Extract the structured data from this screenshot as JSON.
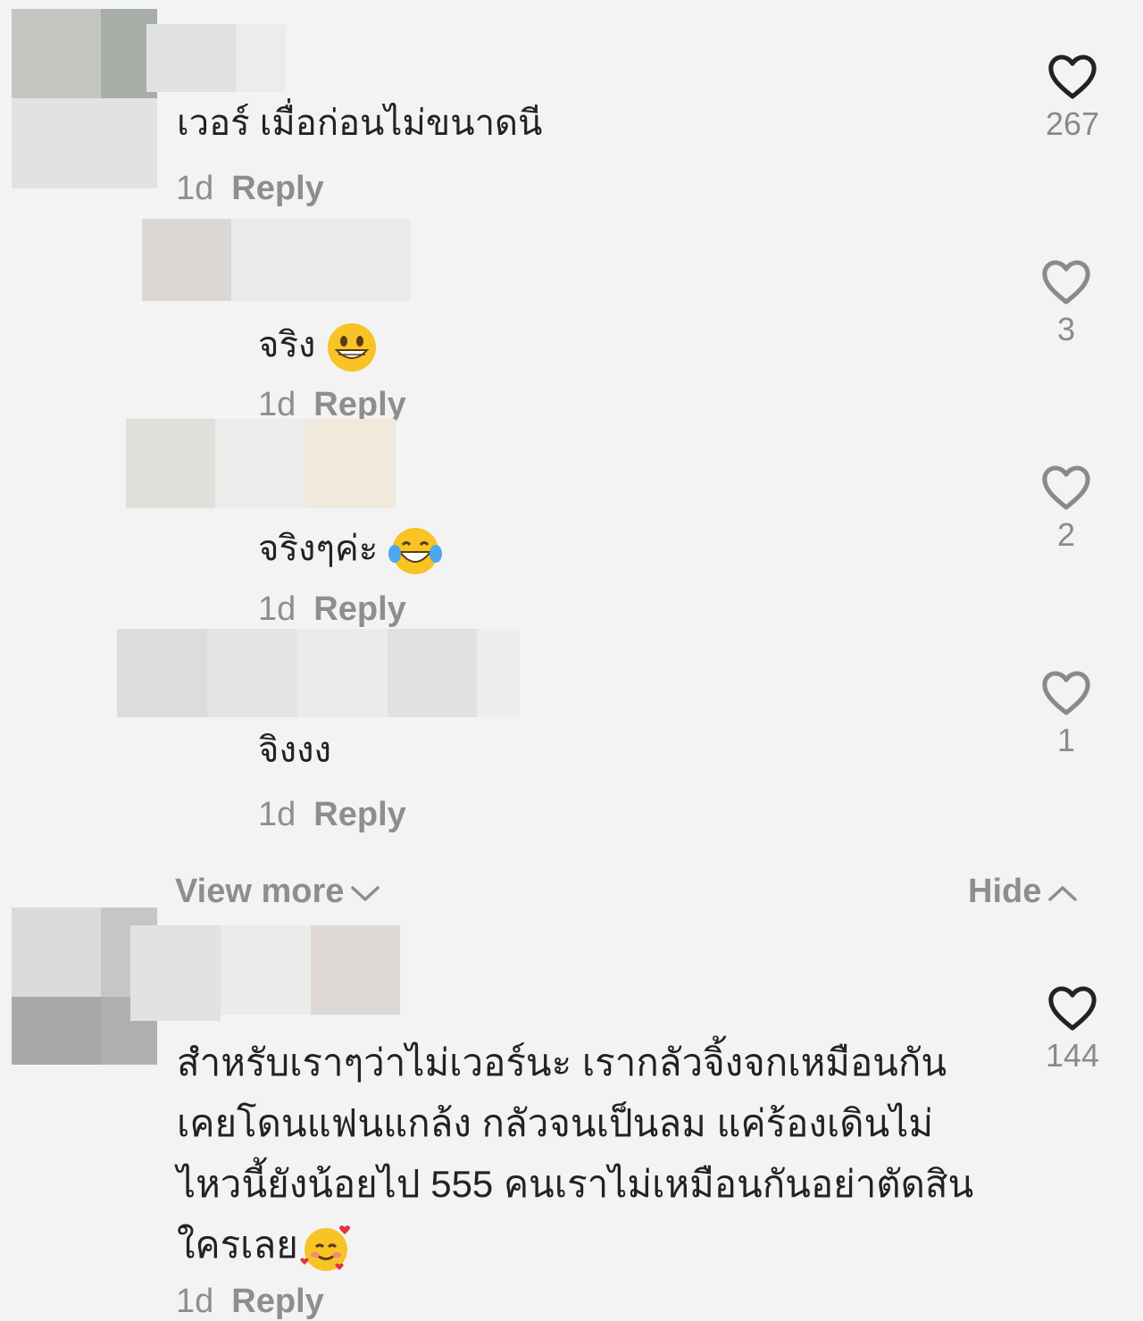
{
  "comments": [
    {
      "text": "เวอร์ เมื่อก่อนไม่ขนาดนี",
      "time": "1d",
      "reply_label": "Reply",
      "likes": "267",
      "replies": [
        {
          "text": "จริง",
          "emoji": "grinning-face",
          "time": "1d",
          "reply_label": "Reply",
          "likes": "3"
        },
        {
          "text": "จริงๆค่ะ",
          "emoji": "face-with-tears-of-joy",
          "time": "1d",
          "reply_label": "Reply",
          "likes": "2"
        },
        {
          "text": "จิงงง",
          "time": "1d",
          "reply_label": "Reply",
          "likes": "1"
        }
      ]
    },
    {
      "text": "สำหรับเราๆว่าไม่เวอร์นะ เรากลัวจิ้งจกเหมือนกันเคยโดนแฟนแกล้ง กลัวจนเป็นลม แค่ร้องเดินไม่ไหวนี้ยังน้อยไป 555 คนเราไม่เหมือนกันอย่าตัดสินใครเลย",
      "emoji": "smiling-face-with-hearts",
      "time": "1d",
      "reply_label": "Reply",
      "likes": "144"
    }
  ],
  "thread_controls": {
    "view_more": "View more",
    "hide": "Hide"
  },
  "colors": {
    "background": "#f3f3f3",
    "text": "#222222",
    "muted": "#8e8e8e"
  }
}
